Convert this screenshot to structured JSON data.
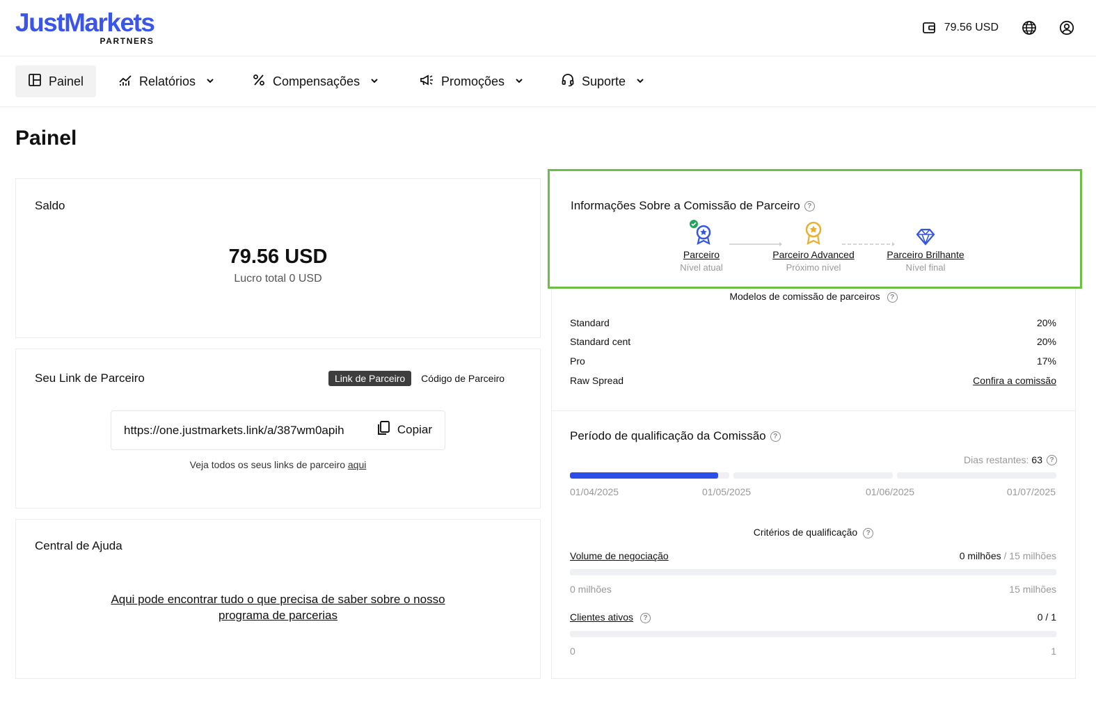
{
  "header": {
    "brand": "JustMarkets",
    "brand_sub": "PARTNERS",
    "balance": "79.56 USD"
  },
  "nav": {
    "items": [
      {
        "label": "Painel",
        "icon": "dashboard-icon",
        "active": true
      },
      {
        "label": "Relatórios",
        "icon": "chart-icon"
      },
      {
        "label": "Compensações",
        "icon": "percent-icon"
      },
      {
        "label": "Promoções",
        "icon": "megaphone-icon"
      },
      {
        "label": "Suporte",
        "icon": "headset-icon"
      }
    ]
  },
  "page": {
    "title": "Painel"
  },
  "saldo": {
    "title": "Saldo",
    "amount": "79.56 USD",
    "profit": "Lucro total 0 USD"
  },
  "partner_link": {
    "title": "Seu Link de Parceiro",
    "tab_link": "Link de Parceiro",
    "tab_code": "Código de Parceiro",
    "url": "https://one.justmarkets.link/a/387wm0apih",
    "copy_label": "Copiar",
    "note": "Veja todos os seus links de parceiro",
    "note_link": "aqui"
  },
  "help": {
    "title": "Central de Ajuda",
    "line1": "Aqui pode encontrar tudo o que precisa de saber sobre o nosso",
    "line2": "programa de parcerias"
  },
  "commission": {
    "title": "Informações Sobre a Comissão de Parceiro",
    "levels": [
      {
        "name": "Parceiro",
        "desc": "Nível atual",
        "icon": "blue-medal-icon",
        "color": "#3355e0"
      },
      {
        "name": "Parceiro Advanced",
        "desc": "Próximo nível",
        "icon": "gold-medal-icon",
        "color": "#e8b030"
      },
      {
        "name": "Parceiro Brilhante",
        "desc": "Nível final",
        "icon": "diamond-icon",
        "color": "#3355e0"
      }
    ],
    "models_title": "Modelos de comissão de parceiros",
    "models": [
      {
        "name": "Standard",
        "value": "20%"
      },
      {
        "name": "Standard cent",
        "value": "20%"
      },
      {
        "name": "Pro",
        "value": "17%"
      },
      {
        "name": "Raw Spread",
        "value": "Confira a comissão"
      }
    ]
  },
  "qualification": {
    "title": "Período de qualificação da Comissão",
    "days_label": "Dias restantes:",
    "days_value": "63",
    "progress_first_segment": 0.93,
    "dates": [
      "01/04/2025",
      "01/05/2025",
      "01/06/2025",
      "01/07/2025"
    ],
    "criteria_title": "Critérios de qualificação",
    "volume": {
      "label": "Volume de negociação",
      "current": "0 milhões",
      "target": "/ 15 milhões",
      "min": "0 milhões",
      "max": "15 milhões"
    },
    "clients": {
      "label": "Clientes ativos",
      "value": "0 / 1",
      "min": "0",
      "max": "1"
    }
  },
  "colors": {
    "accent": "#2b4ee8",
    "highlight_border": "#6cbf45",
    "check": "#22a55a"
  }
}
